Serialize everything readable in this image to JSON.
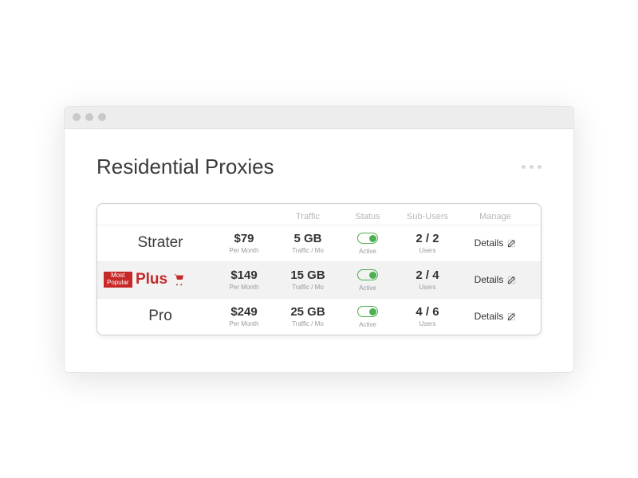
{
  "page": {
    "title": "Residential Proxies"
  },
  "table": {
    "headers": {
      "traffic": "Traffic",
      "status": "Status",
      "subusers": "Sub-Users",
      "manage": "Manage"
    },
    "sublabels": {
      "per_month": "Per Month",
      "traffic_mo": "Traffic / Mo",
      "active": "Active",
      "users": "Users"
    },
    "badge_most_popular": "Most\nPopular",
    "details_label": "Details",
    "plans": [
      {
        "name": "Strater",
        "price": "$79",
        "traffic": "5 GB",
        "subusers": "2 / 2",
        "highlight": false,
        "popular": false
      },
      {
        "name": "Plus",
        "price": "$149",
        "traffic": "15 GB",
        "subusers": "2 / 4",
        "highlight": true,
        "popular": true
      },
      {
        "name": "Pro",
        "price": "$249",
        "traffic": "25 GB",
        "subusers": "4 / 6",
        "highlight": false,
        "popular": false
      }
    ]
  }
}
